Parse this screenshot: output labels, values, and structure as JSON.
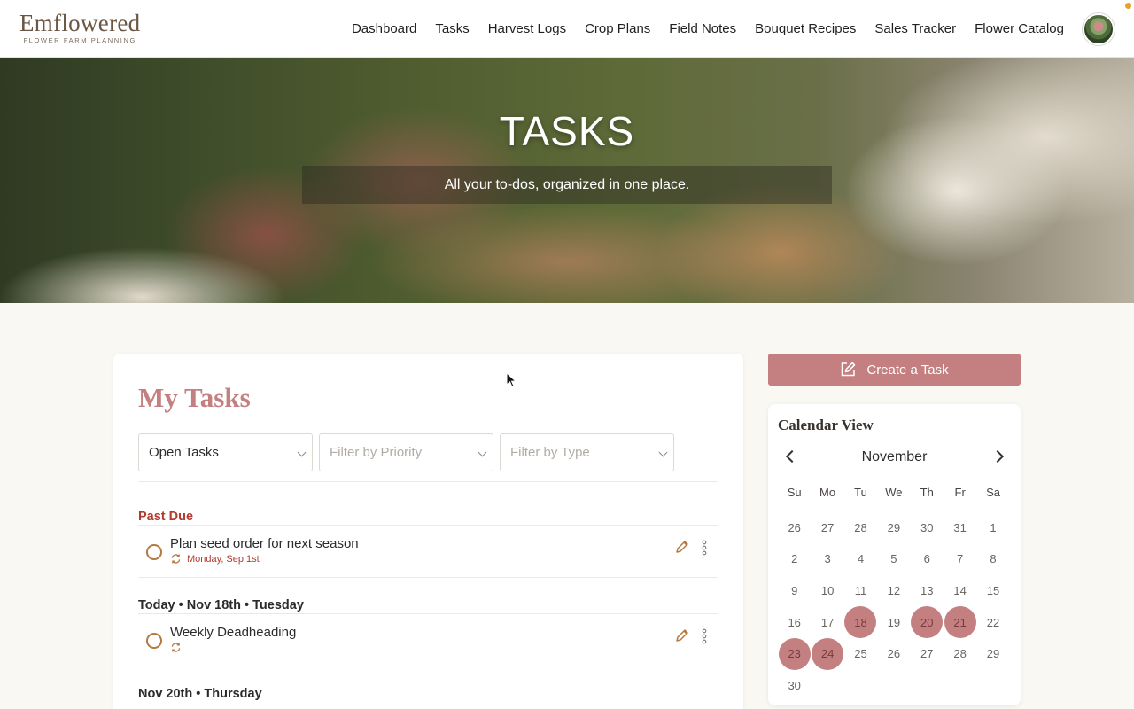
{
  "brand": {
    "name": "Emflowered",
    "tagline": "FLOWER FARM PLANNING"
  },
  "nav": {
    "items": [
      "Dashboard",
      "Tasks",
      "Harvest Logs",
      "Crop Plans",
      "Field Notes",
      "Bouquet Recipes",
      "Sales Tracker",
      "Flower Catalog"
    ]
  },
  "hero": {
    "title": "TASKS",
    "subtitle": "All your to-dos, organized in one place."
  },
  "tasks_panel": {
    "title": "My Tasks",
    "filters": {
      "status": "Open Tasks",
      "priority_placeholder": "Filter by Priority",
      "type_placeholder": "Filter by Type"
    },
    "groups": [
      {
        "label": "Past Due",
        "tasks": [
          {
            "name": "Plan seed order for next season",
            "date": "Monday, Sep 1st",
            "repeating": true
          }
        ]
      },
      {
        "label": "Today • Nov 18th • Tuesday",
        "tasks": [
          {
            "name": "Weekly Deadheading",
            "date": "",
            "repeating": true
          }
        ]
      },
      {
        "label": "Nov 20th • Thursday",
        "tasks": []
      }
    ]
  },
  "create_task": {
    "label": "Create a Task"
  },
  "calendar": {
    "title": "Calendar View",
    "month": "November",
    "weekdays": [
      "Su",
      "Mo",
      "Tu",
      "We",
      "Th",
      "Fr",
      "Sa"
    ],
    "days": [
      "26",
      "27",
      "28",
      "29",
      "30",
      "31",
      "1",
      "2",
      "3",
      "4",
      "5",
      "6",
      "7",
      "8",
      "9",
      "10",
      "11",
      "12",
      "13",
      "14",
      "15",
      "16",
      "17",
      "18",
      "19",
      "20",
      "21",
      "22",
      "23",
      "24",
      "25",
      "26",
      "27",
      "28",
      "29",
      "30"
    ],
    "highlighted_days": [
      "18",
      "20",
      "21",
      "23",
      "24"
    ]
  },
  "colors": {
    "accent": "#c47f80",
    "past_due": "#b43a2e",
    "check_ring": "#b47a42",
    "notification_dot": "#e7a125"
  }
}
